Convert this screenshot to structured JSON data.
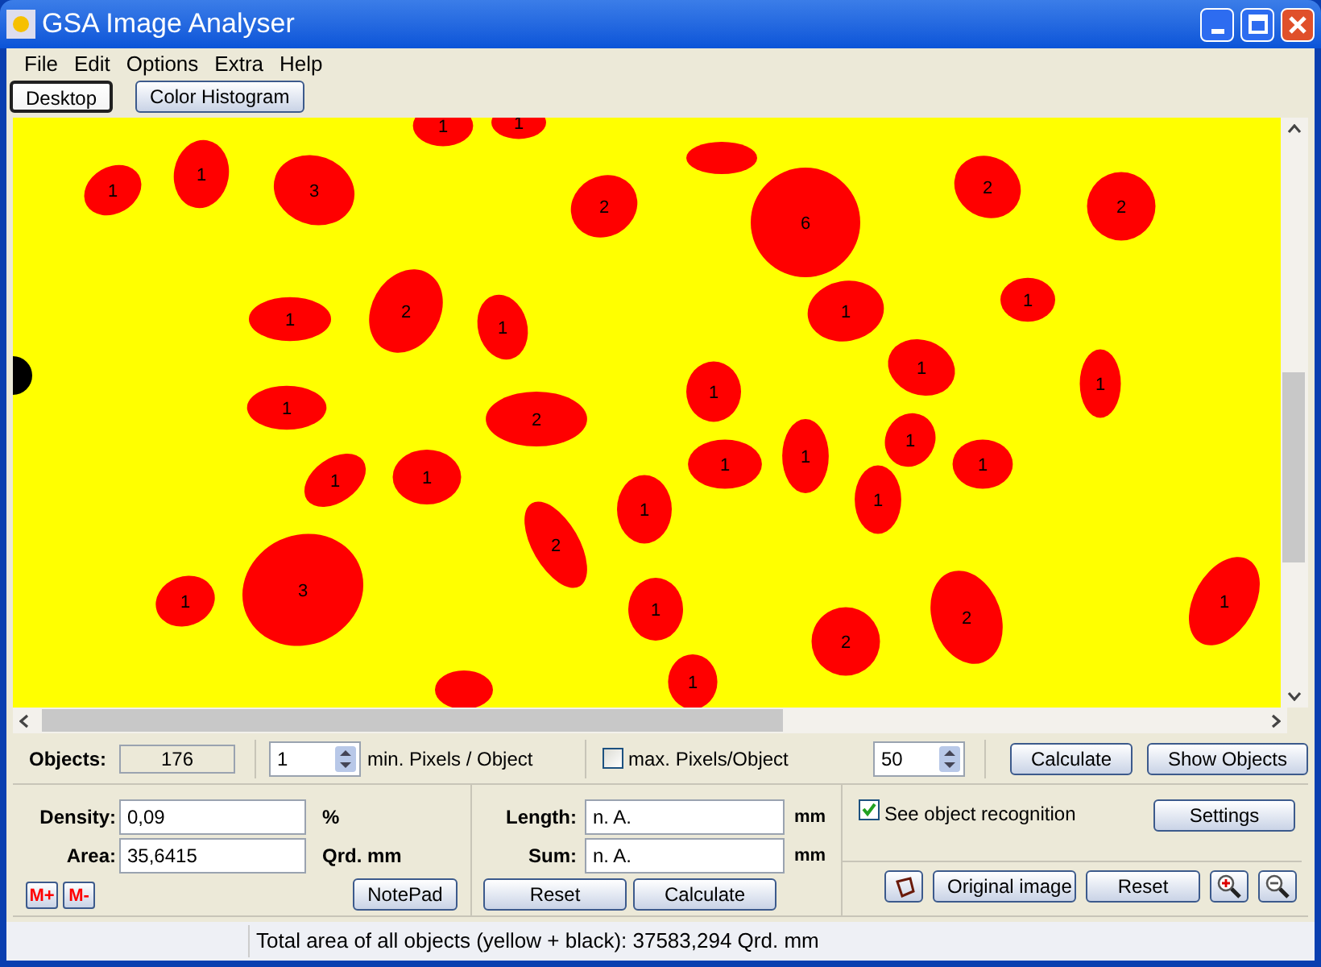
{
  "window": {
    "title": "GSA Image Analyser"
  },
  "menu": [
    "File",
    "Edit",
    "Options",
    "Extra",
    "Help"
  ],
  "toolbar": [
    {
      "label": "Desktop",
      "selected": true
    },
    {
      "label": "Color Histogram",
      "selected": false
    }
  ],
  "image": {
    "object_labels": [
      "1",
      "1",
      "3",
      "1",
      "1",
      "2",
      "6",
      "2",
      "2",
      "1",
      "2",
      "1",
      "1",
      "1",
      "1",
      "1",
      "1",
      "2",
      "1",
      "1",
      "1",
      "1",
      "1",
      "1",
      "1",
      "1",
      "1",
      "2",
      "1",
      "3",
      "1",
      "2",
      "2",
      "1",
      "1"
    ]
  },
  "objects_row": {
    "label": "Objects:",
    "count": "176",
    "min_value": "1",
    "min_label": "min. Pixels / Object",
    "max_checkbox": {
      "label": "max. Pixels/Object",
      "checked": false
    },
    "max_value": "50",
    "buttons": [
      "Calculate",
      "Show Objects"
    ]
  },
  "measure": [
    {
      "label": "Density:",
      "value": "0,09",
      "unit": "%"
    },
    {
      "label": "Area:",
      "value": "35,6415",
      "unit": "Qrd. mm"
    }
  ],
  "memory_buttons": [
    "M+",
    "M-"
  ],
  "notepad_button": "NotePad",
  "length": [
    {
      "label": "Length:",
      "value": "n. A.",
      "unit": "mm"
    },
    {
      "label": "Sum:",
      "value": "n. A.",
      "unit": "mm"
    }
  ],
  "length_buttons": [
    "Reset",
    "Calculate"
  ],
  "recognition": {
    "label": "See object recognition",
    "checked": true
  },
  "settings_button": "Settings",
  "image_buttons": [
    "Original image",
    "Reset"
  ],
  "status_bar": "Total area of all objects (yellow + black): 37583,294 Qrd. mm"
}
